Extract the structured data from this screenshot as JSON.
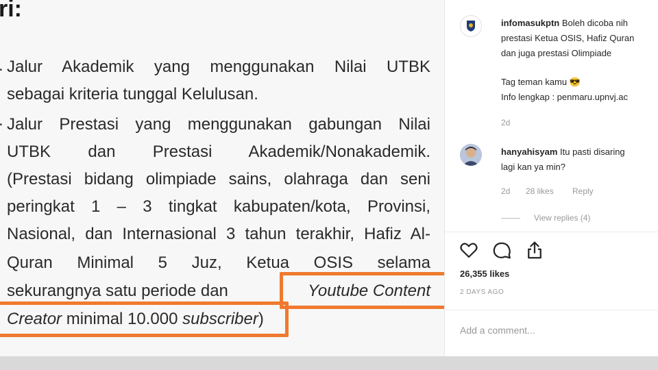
{
  "document": {
    "heading": "ri:",
    "item1_line1": "Jalur Akademik yang menggunakan Nilai UTBK",
    "item1_line2": "sebagai kriteria tunggal Kelulusan.",
    "item2_line1": "Jalur Prestasi yang menggunakan gabungan Nilai",
    "item2_line2": "UTBK dan Prestasi Akademik/Nonakademik.",
    "item2_line3": "(Prestasi bidang olimpiade sains, olahraga dan seni",
    "item2_line4": "peringkat 1 – 3 tingkat kabupaten/kota, Provinsi,",
    "item2_line5": "Nasional, dan Internasional 3 tahun terakhir, Hafiz Al-",
    "item2_line6": "Quran Minimal 5 Juz, Ketua OSIS selama",
    "item2_line7a": "sekurangnya satu periode dan ",
    "item2_line7b": "Youtube Content",
    "item2_line8a": "Creator",
    "item2_line8b": " minimal 10.000 ",
    "item2_line8c": "subscriber",
    "item2_line8d": ")"
  },
  "post": {
    "caption_user": "infomasukptn",
    "caption_line1": "Boleh dicoba nih",
    "caption_line2": "prestasi Ketua OSIS, Hafiz Quran",
    "caption_line3": "dan juga prestasi Olimpiade",
    "caption_line4": "Tag teman kamu 😎",
    "caption_line5": "Info lengkap : penmaru.upnvj.ac",
    "caption_time": "2d",
    "comment_user": "hanyahisyam",
    "comment_line1": "Itu pasti disaring",
    "comment_line2": "lagi kan ya min?",
    "comment_time": "2d",
    "comment_likes": "28 likes",
    "comment_reply": "Reply",
    "view_replies": "View replies (4)",
    "likes": "26,355 likes",
    "date": "2 DAYS AGO",
    "add_comment_placeholder": "Add a comment..."
  },
  "colors": {
    "highlight_border": "#ef7a2f",
    "avatar_badge": "#1f3b7a"
  },
  "icons": [
    "heart-icon",
    "comment-icon",
    "share-icon",
    "university-logo-icon"
  ]
}
